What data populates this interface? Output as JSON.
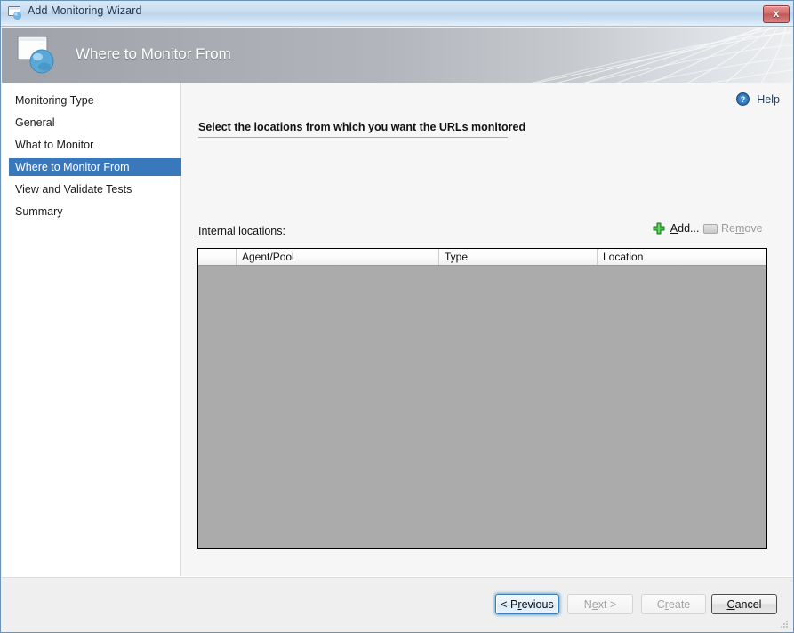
{
  "window": {
    "title": "Add Monitoring Wizard",
    "title_icon": "wizard-window-icon",
    "close_label": "x"
  },
  "banner": {
    "heading": "Where to Monitor From",
    "icon": "monitor-globe-icon"
  },
  "sidebar": {
    "items": [
      {
        "label": "Monitoring Type",
        "selected": false
      },
      {
        "label": "General",
        "selected": false
      },
      {
        "label": "What to Monitor",
        "selected": false
      },
      {
        "label": "Where to Monitor From",
        "selected": true
      },
      {
        "label": "View and Validate Tests",
        "selected": false
      },
      {
        "label": "Summary",
        "selected": false
      }
    ],
    "selected_color": "#3a78bd"
  },
  "content": {
    "help": {
      "label": "Help",
      "icon": "help-question-icon"
    },
    "section_heading": "Select the locations from which you want the URLs monitored",
    "locations_label_pre": "I",
    "locations_label_post": "nternal locations:",
    "add": {
      "pre": "A",
      "post": "dd...",
      "icon": "green-plus-icon",
      "enabled": true
    },
    "remove": {
      "pre": "Re",
      "mid": "m",
      "post": "ove",
      "icon": "remove-bar-icon",
      "enabled": false
    },
    "grid": {
      "columns": [
        "",
        "Agent/Pool",
        "Type",
        "Location"
      ],
      "rows": [],
      "empty_background": "#ababab"
    }
  },
  "footer": {
    "buttons": [
      {
        "name": "previous",
        "pre": "< P",
        "accel": "r",
        "post": "evious",
        "state": "focused"
      },
      {
        "name": "next",
        "pre": "N",
        "accel": "e",
        "post": "xt >",
        "state": "disabled"
      },
      {
        "name": "create",
        "pre": "C",
        "accel": "r",
        "post": "eate",
        "state": "disabled"
      },
      {
        "name": "cancel",
        "pre": "",
        "accel": "C",
        "post": "ancel",
        "state": "default"
      }
    ]
  }
}
